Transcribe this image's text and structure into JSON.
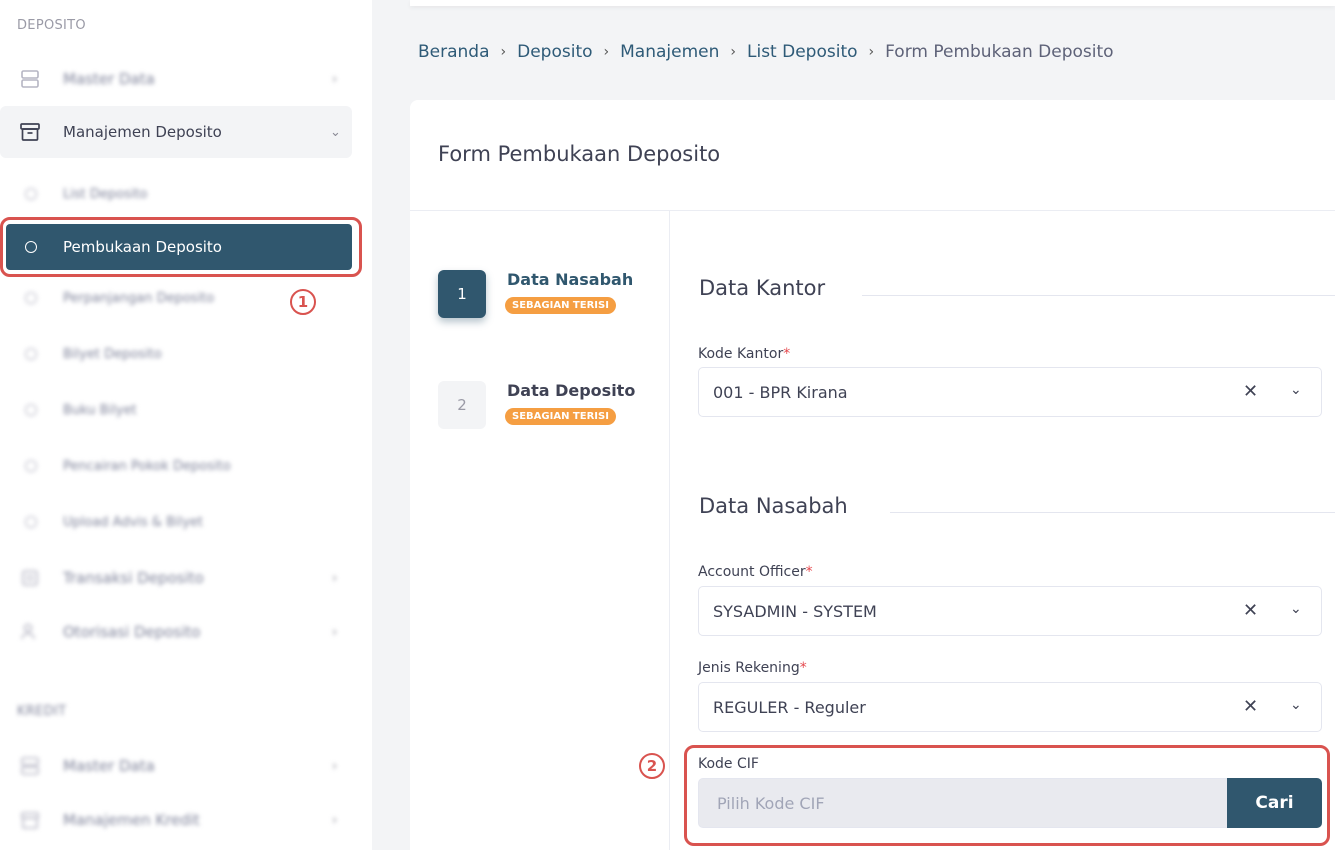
{
  "sidebar": {
    "section_deposito": "DEPOSITO",
    "section_kredit": "KREDIT",
    "deposito_items": [
      {
        "label": "Master Data",
        "icon": "database-icon"
      },
      {
        "label": "Manajemen Deposito",
        "icon": "archive-box-icon"
      },
      {
        "label": "Transaksi Deposito",
        "icon": "transfer-icon"
      },
      {
        "label": "Otorisasi Deposito",
        "icon": "user-check-icon"
      }
    ],
    "manajemen_sub": [
      {
        "label": "List Deposito"
      },
      {
        "label": "Pembukaan Deposito"
      },
      {
        "label": "Perpanjangan Deposito"
      },
      {
        "label": "Bilyet Deposito"
      },
      {
        "label": "Buku Bilyet"
      },
      {
        "label": "Pencairan Pokok Deposito"
      },
      {
        "label": "Upload Advis & Bilyet"
      }
    ],
    "kredit_items": [
      {
        "label": "Master Data",
        "icon": "database-icon"
      },
      {
        "label": "Manajemen Kredit",
        "icon": "archive-box-icon"
      }
    ]
  },
  "annotations": {
    "marker_1": "1",
    "marker_2": "2",
    "color": "#d9534f"
  },
  "breadcrumb": [
    "Beranda",
    "Deposito",
    "Manajemen",
    "List Deposito",
    "Form Pembukaan Deposito"
  ],
  "form": {
    "title": "Form Pembukaan Deposito",
    "steps": [
      {
        "number": "1",
        "name": "Data Nasabah",
        "status": "SEBAGIAN TERISI",
        "active": true
      },
      {
        "number": "2",
        "name": "Data Deposito",
        "status": "SEBAGIAN TERISI",
        "active": false
      }
    ],
    "section_kantor": "Data Kantor",
    "kode_kantor": {
      "label": "Kode Kantor",
      "required": "*",
      "value": "001 - BPR Kirana"
    },
    "section_nasabah": "Data Nasabah",
    "account_officer": {
      "label": "Account Officer",
      "required": "*",
      "value": "SYSADMIN - SYSTEM"
    },
    "jenis_rekening": {
      "label": "Jenis Rekening",
      "required": "*",
      "value": "REGULER - Reguler"
    },
    "kode_cif": {
      "label": "Kode CIF",
      "placeholder": "Pilih Kode CIF",
      "button": "Cari"
    },
    "clear_glyph": "✕",
    "chevron_glyph": "⌄"
  },
  "colors": {
    "primary": "#30576e",
    "warning": "#f59e42",
    "required": "#e5484d"
  }
}
